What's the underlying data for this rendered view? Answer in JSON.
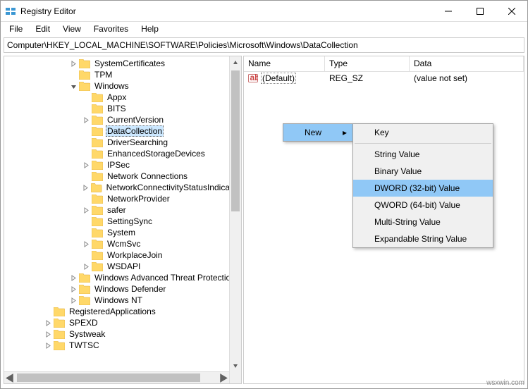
{
  "window": {
    "title": "Registry Editor"
  },
  "menu": {
    "file": "File",
    "edit": "Edit",
    "view": "View",
    "favorites": "Favorites",
    "help": "Help"
  },
  "address": "Computer\\HKEY_LOCAL_MACHINE\\SOFTWARE\\Policies\\Microsoft\\Windows\\DataCollection",
  "tree": [
    {
      "label": "SystemCertificates",
      "indent": 92,
      "expander": "closed"
    },
    {
      "label": "TPM",
      "indent": 92,
      "expander": "none"
    },
    {
      "label": "Windows",
      "indent": 92,
      "expander": "open"
    },
    {
      "label": "Appx",
      "indent": 110,
      "expander": "none"
    },
    {
      "label": "BITS",
      "indent": 110,
      "expander": "none"
    },
    {
      "label": "CurrentVersion",
      "indent": 110,
      "expander": "closed"
    },
    {
      "label": "DataCollection",
      "indent": 110,
      "expander": "none",
      "selected": true
    },
    {
      "label": "DriverSearching",
      "indent": 110,
      "expander": "none"
    },
    {
      "label": "EnhancedStorageDevices",
      "indent": 110,
      "expander": "none"
    },
    {
      "label": "IPSec",
      "indent": 110,
      "expander": "closed"
    },
    {
      "label": "Network Connections",
      "indent": 110,
      "expander": "none"
    },
    {
      "label": "NetworkConnectivityStatusIndicator",
      "indent": 110,
      "expander": "closed"
    },
    {
      "label": "NetworkProvider",
      "indent": 110,
      "expander": "none"
    },
    {
      "label": "safer",
      "indent": 110,
      "expander": "closed"
    },
    {
      "label": "SettingSync",
      "indent": 110,
      "expander": "none"
    },
    {
      "label": "System",
      "indent": 110,
      "expander": "none"
    },
    {
      "label": "WcmSvc",
      "indent": 110,
      "expander": "closed"
    },
    {
      "label": "WorkplaceJoin",
      "indent": 110,
      "expander": "none"
    },
    {
      "label": "WSDAPI",
      "indent": 110,
      "expander": "closed"
    },
    {
      "label": "Windows Advanced Threat Protection",
      "indent": 92,
      "expander": "closed"
    },
    {
      "label": "Windows Defender",
      "indent": 92,
      "expander": "closed"
    },
    {
      "label": "Windows NT",
      "indent": 92,
      "expander": "closed"
    },
    {
      "label": "RegisteredApplications",
      "indent": 56,
      "expander": "none"
    },
    {
      "label": "SPEXD",
      "indent": 56,
      "expander": "closed"
    },
    {
      "label": "Systweak",
      "indent": 56,
      "expander": "closed"
    },
    {
      "label": "TWTSC",
      "indent": 56,
      "expander": "closed"
    }
  ],
  "columns": {
    "name": "Name",
    "type": "Type",
    "data": "Data"
  },
  "values": [
    {
      "name": "(Default)",
      "type": "REG_SZ",
      "data": "(value not set)"
    }
  ],
  "context": {
    "new": "New",
    "sub": {
      "key": "Key",
      "string": "String Value",
      "binary": "Binary Value",
      "dword": "DWORD (32-bit) Value",
      "qword": "QWORD (64-bit) Value",
      "multi": "Multi-String Value",
      "expand": "Expandable String Value"
    }
  },
  "watermark": "wsxwin.com"
}
